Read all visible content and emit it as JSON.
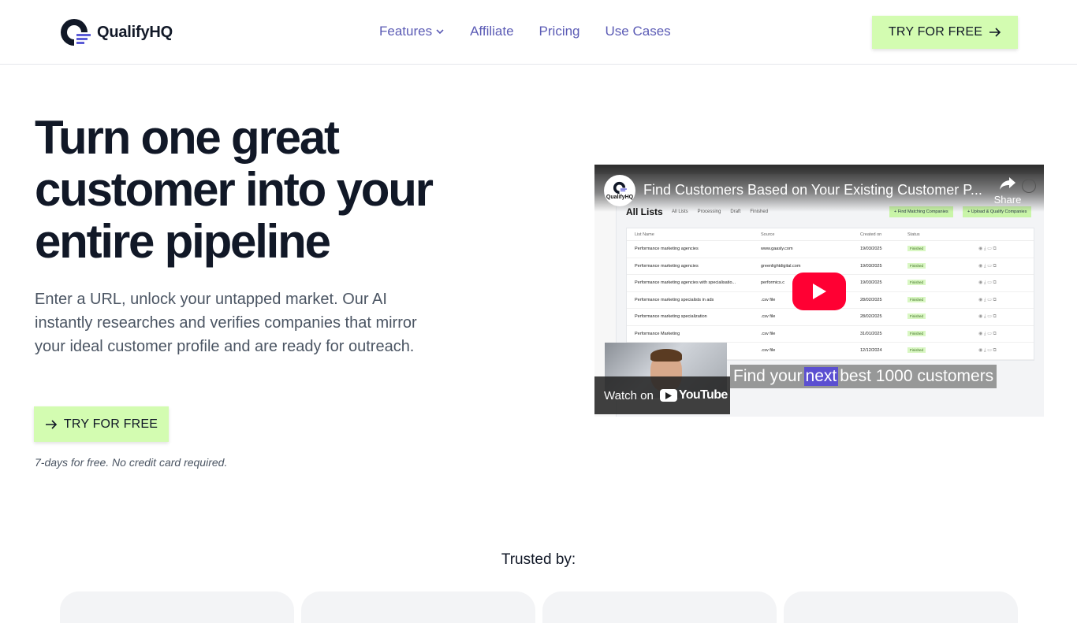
{
  "header": {
    "brand": "QualifyHQ",
    "nav": [
      {
        "label": "Features",
        "has_dropdown": true
      },
      {
        "label": "Affiliate"
      },
      {
        "label": "Pricing"
      },
      {
        "label": "Use Cases"
      }
    ],
    "cta_label": "TRY FOR FREE"
  },
  "hero": {
    "title": "Turn one great customer into your entire pipeline",
    "subtitle": "Enter a URL, unlock your untapped market. Our AI instantly researches and verifies companies that mirror your ideal customer profile and are ready for outreach.",
    "cta_label": "TRY FOR FREE",
    "note": "7-days for free. No credit card required."
  },
  "video": {
    "channel_label": "QualifyHQ",
    "title": "Find Customers Based on Your Existing Customer P...",
    "share_label": "Share",
    "watch_on": "Watch on",
    "youtube_label": "YouTube",
    "caption_before": "Find your",
    "caption_highlight": "next",
    "caption_after": "best 1000 customers",
    "app": {
      "heading": "All Lists",
      "tabs": [
        "All Lists",
        "Processing",
        "Draft",
        "Finished"
      ],
      "btn_match": "+ Find Matching Companies",
      "btn_upload": "+ Upload & Qualify Companies",
      "columns": [
        "List Name",
        "Source",
        "Created on",
        "Status"
      ],
      "rows": [
        {
          "name": "Performance marketing agencies",
          "source": "www.gaasly.com",
          "date": "19/03/2025",
          "status": "Finished"
        },
        {
          "name": "Performance marketing agencies",
          "source": "greenlightdigital.com",
          "date": "19/03/2025",
          "status": "Finished"
        },
        {
          "name": "Performance marketing agencies with specialisatio...",
          "source": "performics.c",
          "date": "19/03/2025",
          "status": "Finished"
        },
        {
          "name": "Performance marketing specialists in ads",
          "source": ".csv file",
          "date": "28/02/2025",
          "status": "Finished"
        },
        {
          "name": "Performance marketing specialization",
          "source": ".csv file",
          "date": "28/02/2025",
          "status": "Finished"
        },
        {
          "name": "Performance Marketing",
          "source": ".csv file",
          "date": "31/01/2025",
          "status": "Finished"
        },
        {
          "name": "",
          "source": ".csv file",
          "date": "12/12/2024",
          "status": "Finished"
        }
      ]
    }
  },
  "trusted": {
    "label": "Trusted by:"
  },
  "colors": {
    "accent_green": "#d3fcb1",
    "nav_purple": "#5b5bb5",
    "youtube_red": "#ff0033",
    "text_dark": "#111827"
  }
}
